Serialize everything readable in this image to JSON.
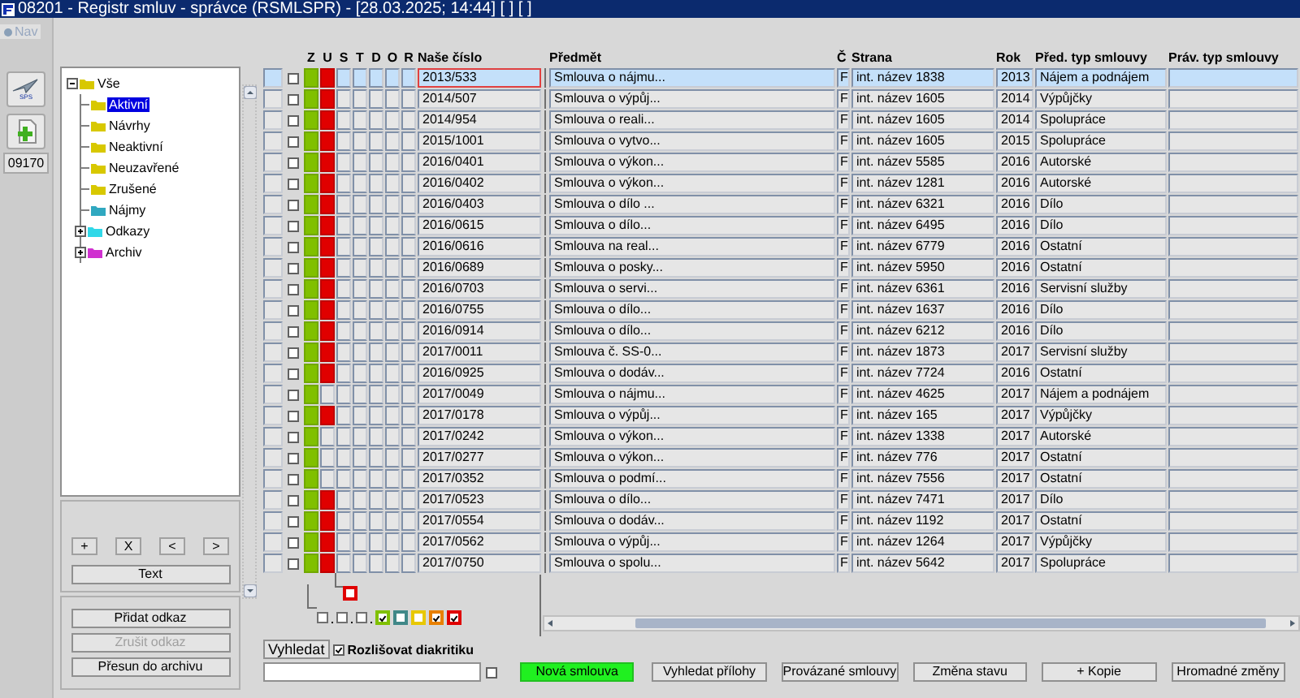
{
  "window": {
    "title": "08201 - Registr smluv - správce (RSMLSPR) - [28.03.2025; 14:44]  [ ]  [ ]"
  },
  "nav": {
    "label": "Nav",
    "disabled": true
  },
  "side_tools": [
    {
      "kind": "sps",
      "label": "SPS"
    },
    {
      "kind": "add"
    }
  ],
  "code_badge": "09170",
  "tree": [
    {
      "label": "Vše",
      "color": "#d8c800",
      "expanded": true,
      "children": [
        {
          "label": "Aktivní",
          "color": "#d8c800",
          "selected": true
        },
        {
          "label": "Návrhy",
          "color": "#d8c800",
          "selected": false
        },
        {
          "label": "Neaktivní",
          "color": "#d8c800",
          "selected": false
        },
        {
          "label": "Neuzavřené",
          "color": "#d8c800",
          "selected": false
        },
        {
          "label": "Zrušené",
          "color": "#d8c800",
          "selected": false
        },
        {
          "label": "Nájmy",
          "color": "#30a8c0",
          "selected": false
        },
        {
          "label": "Odkazy",
          "color": "#30d8e8",
          "selected": false,
          "expanded": false
        },
        {
          "label": "Archiv",
          "color": "#d030d0",
          "selected": false,
          "expanded": false
        }
      ]
    }
  ],
  "tree_buttons": [
    "+",
    "X",
    "<",
    ">"
  ],
  "text_button": "Text",
  "link_buttons": [
    {
      "label": "Přidat odkaz",
      "disabled": false
    },
    {
      "label": "Zrušit odkaz",
      "disabled": true
    },
    {
      "label": "Přesun do archivu",
      "disabled": false
    }
  ],
  "table": {
    "flag_columns": [
      "Z",
      "U",
      "S",
      "T",
      "D",
      "O",
      "R"
    ],
    "columns": [
      "Naše číslo",
      "Předmět",
      "Č",
      "Strana",
      "Rok",
      "Před. typ smlouvy",
      "Práv. typ smlouvy"
    ],
    "rows": [
      {
        "selected": true,
        "checked": false,
        "z": true,
        "u": true,
        "cells": [
          "2013/533",
          "Smlouva o nájmu...",
          "F",
          "int. název 1838",
          "2013",
          "Nájem a podnájem",
          ""
        ]
      },
      {
        "selected": false,
        "checked": false,
        "z": true,
        "u": true,
        "cells": [
          "2014/507",
          "Smlouva o výpůj...",
          "F",
          "int. název 1605",
          "2014",
          "Výpůjčky",
          ""
        ]
      },
      {
        "selected": false,
        "checked": false,
        "z": true,
        "u": true,
        "cells": [
          "2014/954",
          "Smlouva o reali...",
          "F",
          "int. název 1605",
          "2014",
          "Spolupráce",
          ""
        ]
      },
      {
        "selected": false,
        "checked": false,
        "z": true,
        "u": true,
        "cells": [
          "2015/1001",
          "Smlouva o vytvo...",
          "F",
          "int. název 1605",
          "2015",
          "Spolupráce",
          ""
        ]
      },
      {
        "selected": false,
        "checked": false,
        "z": true,
        "u": true,
        "cells": [
          "2016/0401",
          "Smlouva o výkon...",
          "F",
          "int. název 5585",
          "2016",
          "Autorské",
          ""
        ]
      },
      {
        "selected": false,
        "checked": false,
        "z": true,
        "u": true,
        "cells": [
          "2016/0402",
          "Smlouva o výkon...",
          "F",
          "int. název 1281",
          "2016",
          "Autorské",
          ""
        ]
      },
      {
        "selected": false,
        "checked": false,
        "z": true,
        "u": true,
        "cells": [
          "2016/0403",
          "Smlouva o dílo ...",
          "F",
          "int. název 6321",
          "2016",
          "Dílo",
          ""
        ]
      },
      {
        "selected": false,
        "checked": false,
        "z": true,
        "u": true,
        "cells": [
          "2016/0615",
          "Smlouva o dílo...",
          "F",
          "int. název 6495",
          "2016",
          "Dílo",
          ""
        ]
      },
      {
        "selected": false,
        "checked": false,
        "z": true,
        "u": true,
        "cells": [
          "2016/0616",
          "Smlouva na real...",
          "F",
          "int. název 6779",
          "2016",
          "Ostatní",
          ""
        ]
      },
      {
        "selected": false,
        "checked": false,
        "z": true,
        "u": true,
        "cells": [
          "2016/0689",
          "Smlouva o posky...",
          "F",
          "int. název 5950",
          "2016",
          "Ostatní",
          ""
        ]
      },
      {
        "selected": false,
        "checked": false,
        "z": true,
        "u": true,
        "cells": [
          "2016/0703",
          "Smlouva o servi...",
          "F",
          "int. název 6361",
          "2016",
          "Servisní služby",
          ""
        ]
      },
      {
        "selected": false,
        "checked": false,
        "z": true,
        "u": true,
        "cells": [
          "2016/0755",
          "Smlouva o dílo...",
          "F",
          "int. název 1637",
          "2016",
          "Dílo",
          ""
        ]
      },
      {
        "selected": false,
        "checked": false,
        "z": true,
        "u": true,
        "cells": [
          "2016/0914",
          "Smlouva o dílo...",
          "F",
          "int. název 6212",
          "2016",
          "Dílo",
          ""
        ]
      },
      {
        "selected": false,
        "checked": false,
        "z": true,
        "u": true,
        "cells": [
          "2017/0011",
          "Smlouva č. SS-0...",
          "F",
          "int. název 1873",
          "2017",
          "Servisní služby",
          ""
        ]
      },
      {
        "selected": false,
        "checked": false,
        "z": true,
        "u": true,
        "cells": [
          "2016/0925",
          "Smlouva o dodáv...",
          "F",
          "int. název 7724",
          "2016",
          "Ostatní",
          ""
        ]
      },
      {
        "selected": false,
        "checked": false,
        "z": true,
        "u": false,
        "cells": [
          "2017/0049",
          "Smlouva o nájmu...",
          "F",
          "int. název 4625",
          "2017",
          "Nájem a podnájem",
          ""
        ]
      },
      {
        "selected": false,
        "checked": false,
        "z": true,
        "u": true,
        "cells": [
          "2017/0178",
          "Smlouva o výpůj...",
          "F",
          "int. název 165",
          "2017",
          "Výpůjčky",
          ""
        ]
      },
      {
        "selected": false,
        "checked": false,
        "z": true,
        "u": false,
        "cells": [
          "2017/0242",
          "Smlouva o výkon...",
          "F",
          "int. název 1338",
          "2017",
          "Autorské",
          ""
        ]
      },
      {
        "selected": false,
        "checked": false,
        "z": true,
        "u": false,
        "cells": [
          "2017/0277",
          "Smlouva o výkon...",
          "F",
          "int. název 776",
          "2017",
          "Ostatní",
          ""
        ]
      },
      {
        "selected": false,
        "checked": false,
        "z": true,
        "u": false,
        "cells": [
          "2017/0352",
          "Smlouva o podmí...",
          "F",
          "int. název 7556",
          "2017",
          "Ostatní",
          ""
        ]
      },
      {
        "selected": false,
        "checked": false,
        "z": true,
        "u": true,
        "cells": [
          "2017/0523",
          "Smlouva o dílo...",
          "F",
          "int. název 7471",
          "2017",
          "Dílo",
          ""
        ]
      },
      {
        "selected": false,
        "checked": false,
        "z": true,
        "u": true,
        "cells": [
          "2017/0554",
          "Smlouva o dodáv...",
          "F",
          "int. název 1192",
          "2017",
          "Ostatní",
          ""
        ]
      },
      {
        "selected": false,
        "checked": false,
        "z": true,
        "u": true,
        "cells": [
          "2017/0562",
          "Smlouva o výpůj...",
          "F",
          "int. název 1264",
          "2017",
          "Výpůjčky",
          ""
        ]
      },
      {
        "selected": false,
        "checked": false,
        "z": true,
        "u": true,
        "cells": [
          "2017/0750",
          "Smlouva o spolu...",
          "F",
          "int. název 5642",
          "2017",
          "Spolupráce",
          ""
        ]
      }
    ]
  },
  "legend_u": {
    "checked": false,
    "color": "#e00000"
  },
  "legend": [
    {
      "checked": false
    },
    {
      "checked": false
    },
    {
      "checked": false
    },
    {
      "checked": true,
      "color": "#80c000"
    },
    {
      "checked": false,
      "color": "#408888"
    },
    {
      "checked": false,
      "color": "#e8c800"
    },
    {
      "checked": true,
      "color": "#e88000"
    },
    {
      "checked": true,
      "color": "#e00000"
    }
  ],
  "search": {
    "button": "Vyhledat",
    "diacritics_label": "Rozlišovat diakritiku",
    "diacritics_checked": true,
    "extra_checked": false
  },
  "actions": [
    {
      "label": "Nová smlouva",
      "kind": "primary"
    },
    {
      "label": "Vyhledat přílohy",
      "kind": "normal"
    },
    {
      "label": "Provázané smlouvy",
      "kind": "normal"
    },
    {
      "label": "Změna stavu",
      "kind": "normal"
    },
    {
      "label": "+ Kopie",
      "kind": "normal"
    },
    {
      "label": "Hromadné změny",
      "kind": "normal"
    }
  ]
}
